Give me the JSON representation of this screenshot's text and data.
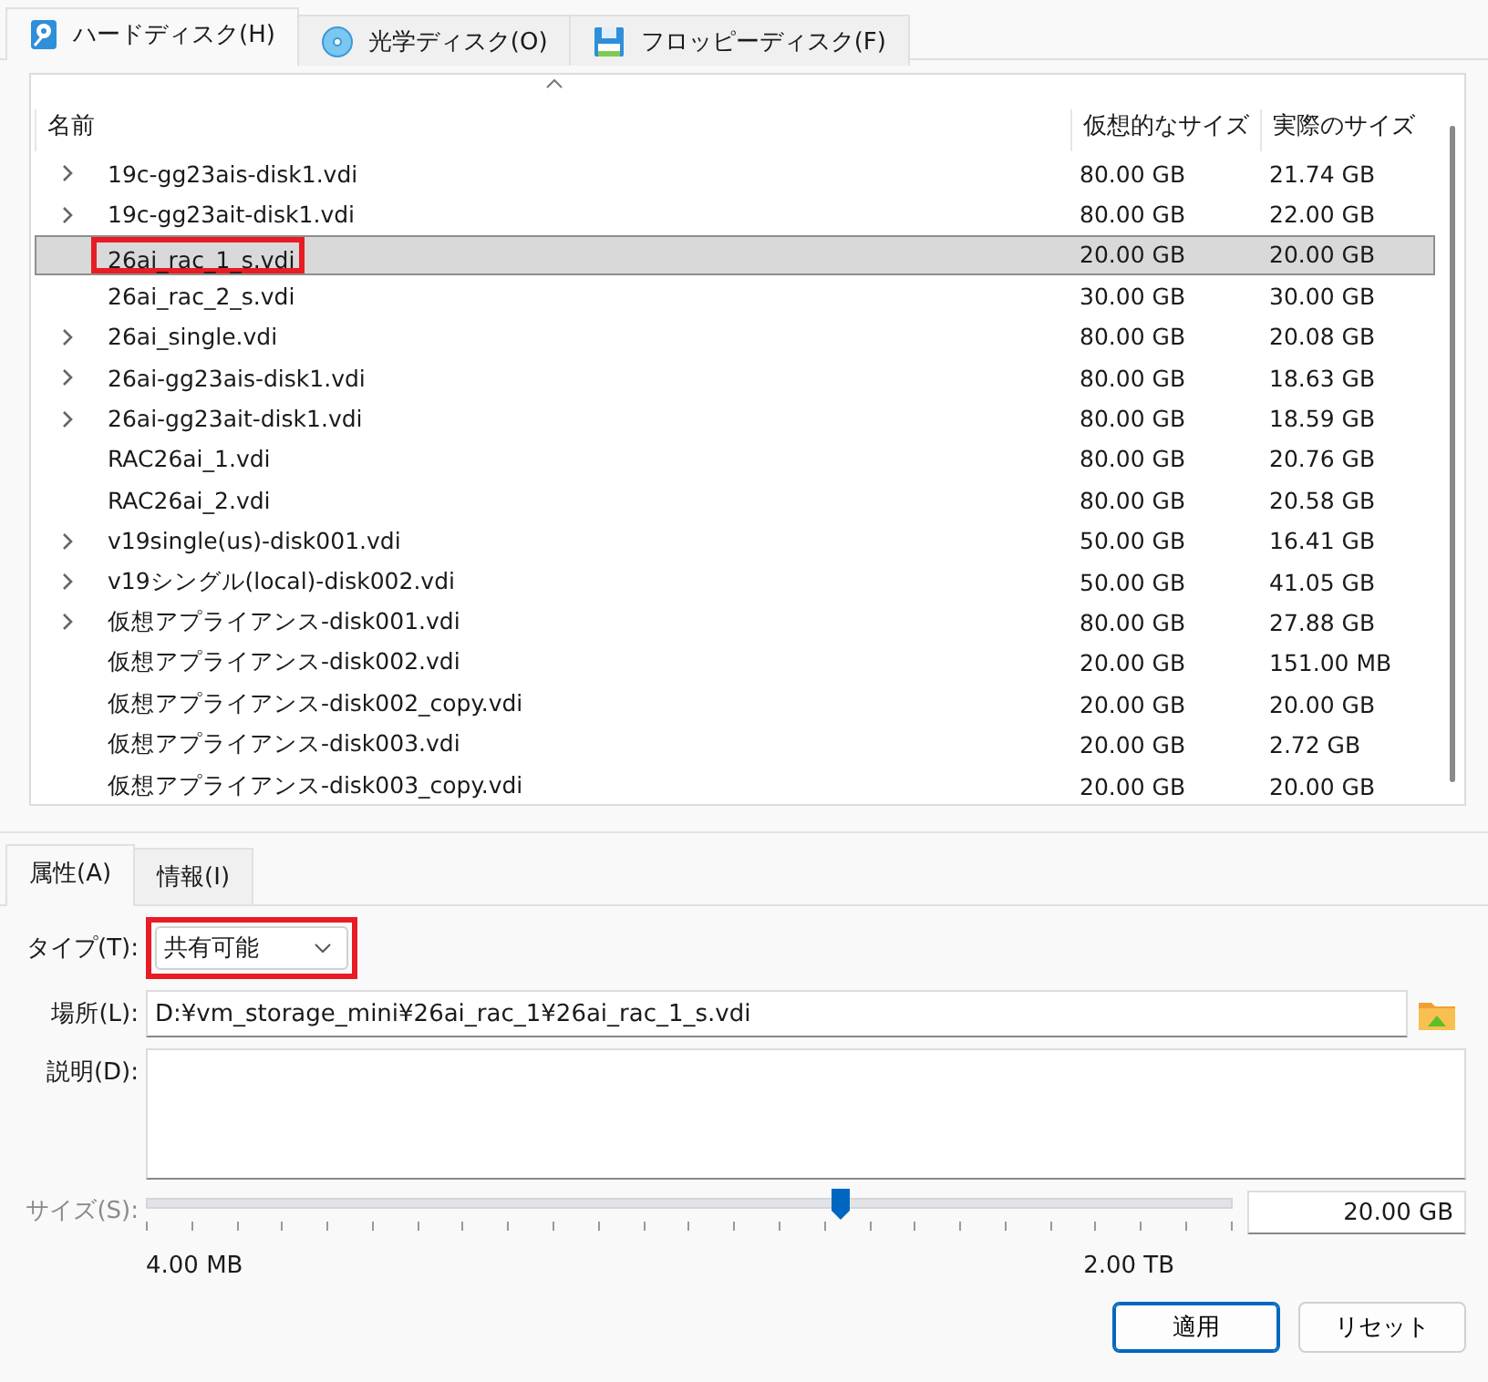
{
  "tabs": [
    {
      "label": "ハードディスク(H)",
      "kind": "hdd",
      "selected": true
    },
    {
      "label": "光学ディスク(O)",
      "kind": "optical",
      "selected": false
    },
    {
      "label": "フロッピーディスク(F)",
      "kind": "floppy",
      "selected": false
    }
  ],
  "table": {
    "columns": [
      "名前",
      "仮想的なサイズ",
      "実際のサイズ"
    ],
    "rows": [
      {
        "name": "19c-gg23ais-disk1.vdi",
        "virtual": "80.00 GB",
        "actual": "21.74 GB",
        "expandable": true,
        "selected": false,
        "annotated": false
      },
      {
        "name": "19c-gg23ait-disk1.vdi",
        "virtual": "80.00 GB",
        "actual": "22.00 GB",
        "expandable": true,
        "selected": false,
        "annotated": false
      },
      {
        "name": "26ai_rac_1_s.vdi",
        "virtual": "20.00 GB",
        "actual": "20.00 GB",
        "expandable": false,
        "selected": true,
        "annotated": true
      },
      {
        "name": "26ai_rac_2_s.vdi",
        "virtual": "30.00 GB",
        "actual": "30.00 GB",
        "expandable": false,
        "selected": false,
        "annotated": false
      },
      {
        "name": "26ai_single.vdi",
        "virtual": "80.00 GB",
        "actual": "20.08 GB",
        "expandable": true,
        "selected": false,
        "annotated": false
      },
      {
        "name": "26ai-gg23ais-disk1.vdi",
        "virtual": "80.00 GB",
        "actual": "18.63 GB",
        "expandable": true,
        "selected": false,
        "annotated": false
      },
      {
        "name": "26ai-gg23ait-disk1.vdi",
        "virtual": "80.00 GB",
        "actual": "18.59 GB",
        "expandable": true,
        "selected": false,
        "annotated": false
      },
      {
        "name": "RAC26ai_1.vdi",
        "virtual": "80.00 GB",
        "actual": "20.76 GB",
        "expandable": false,
        "selected": false,
        "annotated": false
      },
      {
        "name": "RAC26ai_2.vdi",
        "virtual": "80.00 GB",
        "actual": "20.58 GB",
        "expandable": false,
        "selected": false,
        "annotated": false
      },
      {
        "name": "v19single(us)-disk001.vdi",
        "virtual": "50.00 GB",
        "actual": "16.41 GB",
        "expandable": true,
        "selected": false,
        "annotated": false
      },
      {
        "name": "v19シングル(local)-disk002.vdi",
        "virtual": "50.00 GB",
        "actual": "41.05 GB",
        "expandable": true,
        "selected": false,
        "annotated": false
      },
      {
        "name": "仮想アプライアンス-disk001.vdi",
        "virtual": "80.00 GB",
        "actual": "27.88 GB",
        "expandable": true,
        "selected": false,
        "annotated": false
      },
      {
        "name": "仮想アプライアンス-disk002.vdi",
        "virtual": "20.00 GB",
        "actual": "151.00 MB",
        "expandable": false,
        "selected": false,
        "annotated": false
      },
      {
        "name": "仮想アプライアンス-disk002_copy.vdi",
        "virtual": "20.00 GB",
        "actual": "20.00 GB",
        "expandable": false,
        "selected": false,
        "annotated": false
      },
      {
        "name": "仮想アプライアンス-disk003.vdi",
        "virtual": "20.00 GB",
        "actual": "2.72 GB",
        "expandable": false,
        "selected": false,
        "annotated": false
      },
      {
        "name": "仮想アプライアンス-disk003_copy.vdi",
        "virtual": "20.00 GB",
        "actual": "20.00 GB",
        "expandable": false,
        "selected": false,
        "annotated": false
      }
    ]
  },
  "detail_tabs": [
    {
      "label": "属性(A)",
      "selected": true
    },
    {
      "label": "情報(I)",
      "selected": false
    }
  ],
  "type": {
    "label": "タイプ(T):",
    "value": "共有可能",
    "annotated": true
  },
  "location": {
    "label": "場所(L):",
    "value": "D:¥vm_storage_mini¥26ai_rac_1¥26ai_rac_1_s.vdi"
  },
  "description": {
    "label": "説明(D):"
  },
  "size": {
    "label": "サイズ(S):",
    "disabled": true,
    "level": 0.64,
    "value": "20.00 GB",
    "min_label": "4.00 MB",
    "max_label": "2.00 TB"
  },
  "buttons": [
    {
      "label": "適用",
      "kind": "default"
    },
    {
      "label": "リセット",
      "kind": "normal"
    }
  ]
}
